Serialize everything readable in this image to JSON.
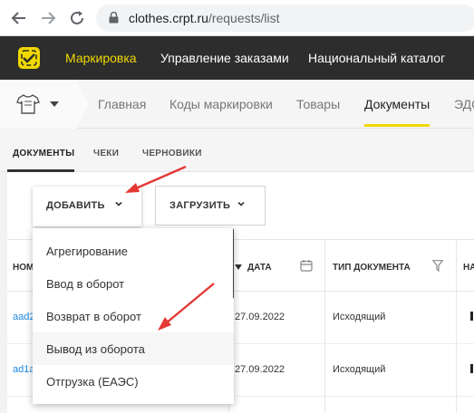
{
  "browser": {
    "url_host": "clothes.crpt.ru",
    "url_path": "/requests/list"
  },
  "topnav": {
    "items": [
      "Маркировка",
      "Управление заказами",
      "Национальный каталог"
    ],
    "active_color": "#f0d800"
  },
  "subnav": {
    "items": [
      "Главная",
      "Коды маркировки",
      "Товары",
      "Документы",
      "ЭДО"
    ],
    "active": "Документы"
  },
  "doctabs": {
    "items": [
      "ДОКУМЕНТЫ",
      "ЧЕКИ",
      "ЧЕРНОВИКИ"
    ],
    "active": "ДОКУМЕНТЫ"
  },
  "toolbar": {
    "add_label": "ДОБАВИТЬ",
    "upload_label": "ЗАГРУЗИТЬ"
  },
  "table": {
    "headers": {
      "number": "НОМ",
      "date": "ДАТА",
      "doc_type": "ТИП ДОКУМЕНТА",
      "extra": "НА"
    },
    "rows": [
      {
        "number": "aad2",
        "date": "27.09.2022",
        "doc_type": "Исходящий"
      },
      {
        "number": "ad1a",
        "date": "27.09.2022",
        "doc_type": "Исходящий"
      }
    ]
  },
  "dropdown": {
    "items": [
      "Агрегирование",
      "Ввод в оборот",
      "Возврат в оборот",
      "Вывод из оборота",
      "Отгрузка (ЕАЭС)"
    ],
    "hovered": "Вывод из оборота"
  },
  "annotations": {
    "arrow_color": "#e53935"
  },
  "icons": [
    "back-arrow-icon",
    "forward-arrow-icon",
    "reload-icon",
    "lock-icon",
    "logo-icon",
    "shirt-icon",
    "chevron-down-icon",
    "calendar-icon",
    "filter-icon",
    "sort-down-icon"
  ]
}
